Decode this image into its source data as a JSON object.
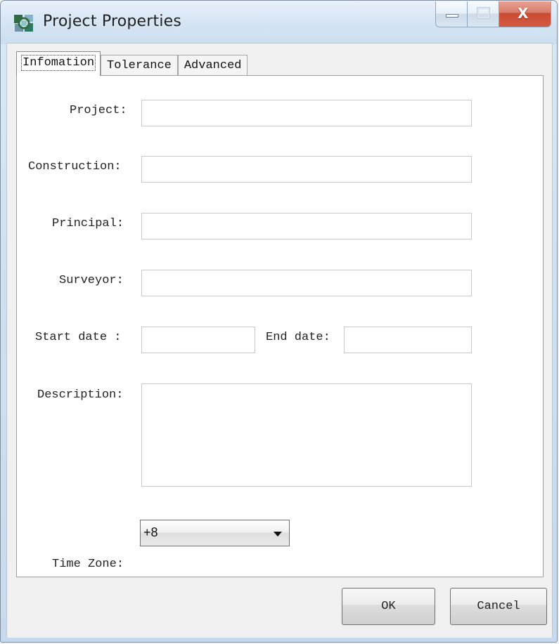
{
  "window": {
    "title": "Project Properties",
    "icon": "project-properties-app-icon",
    "controls": {
      "minimize": "minimize-icon",
      "maximize": "maximize-icon",
      "close": "close-icon",
      "close_glyph": "X"
    }
  },
  "tabs": [
    {
      "label": "Infomation",
      "active": true
    },
    {
      "label": "Tolerance",
      "active": false
    },
    {
      "label": "Advanced",
      "active": false
    }
  ],
  "form": {
    "project_label": "Project:",
    "project_value": "",
    "construction_label": "Construction:",
    "construction_value": "",
    "principal_label": "Principal:",
    "principal_value": "",
    "surveyor_label": "Surveyor:",
    "surveyor_value": "",
    "start_date_label": "Start date :",
    "start_date_value": "",
    "end_date_label": "End date:",
    "end_date_value": "",
    "description_label": "Description:",
    "description_value": "",
    "time_zone_label": "Time Zone:",
    "time_zone_value": "+8"
  },
  "buttons": {
    "ok": "OK",
    "cancel": "Cancel"
  },
  "colors": {
    "title_gradient_top": "#e7f0fa",
    "close_button": "#c94a31",
    "panel_background": "#ffffff"
  }
}
